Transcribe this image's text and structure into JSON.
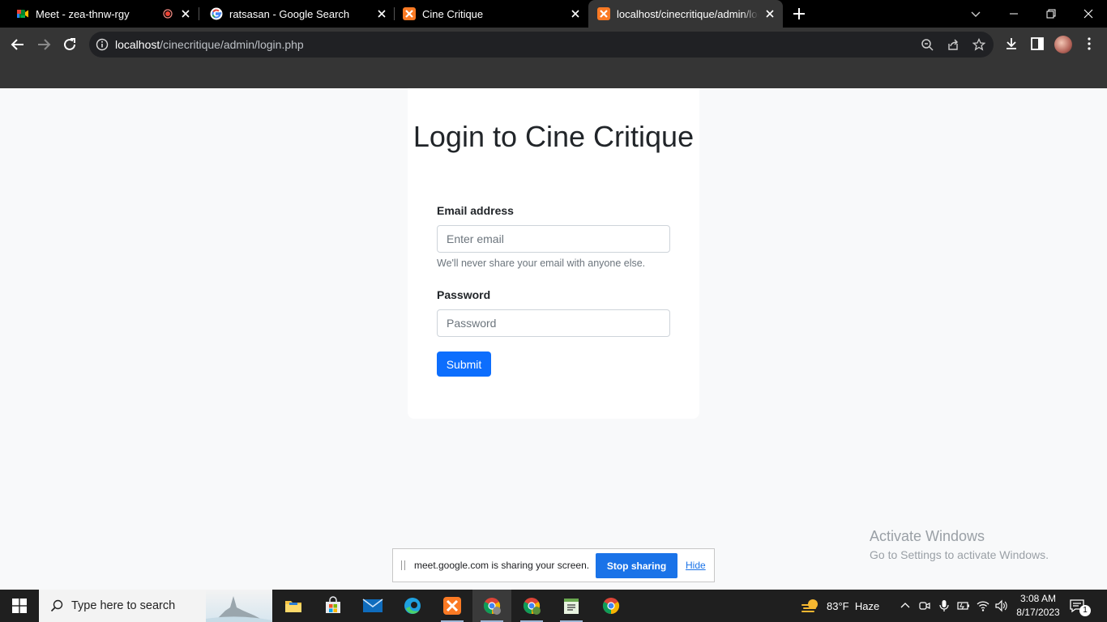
{
  "browser": {
    "tabs": [
      {
        "title": "Meet - zea-thnw-rgy",
        "favicon": "google-meet-icon",
        "recording": true
      },
      {
        "title": "ratsasan - Google Search",
        "favicon": "google-icon"
      },
      {
        "title": "Cine Critique",
        "favicon": "xampp-icon"
      },
      {
        "title": "localhost/cinecritique/admin/login.php",
        "favicon": "xampp-icon",
        "active": true
      }
    ],
    "address": {
      "host": "localhost",
      "path": "/cinecritique/admin/login.php"
    }
  },
  "login": {
    "title": "Login to Cine Critique",
    "email_label": "Email address",
    "email_placeholder": "Enter email",
    "email_help": "We'll never share your email with anyone else.",
    "password_label": "Password",
    "password_placeholder": "Password",
    "submit_label": "Submit"
  },
  "watermark": {
    "line1": "Activate Windows",
    "line2": "Go to Settings to activate Windows."
  },
  "share_bar": {
    "message": "meet.google.com is sharing your screen.",
    "stop_label": "Stop sharing",
    "hide_label": "Hide"
  },
  "taskbar": {
    "search_placeholder": "Type here to search",
    "weather": {
      "temp": "83°F",
      "condition": "Haze"
    },
    "time": "3:08 AM",
    "date": "8/17/2023",
    "notification_count": "1"
  },
  "colors": {
    "primary": "#0d6efd",
    "share_blue": "#1a73e8",
    "page_bg": "#f8f9fa",
    "chrome_dark": "#353535"
  }
}
